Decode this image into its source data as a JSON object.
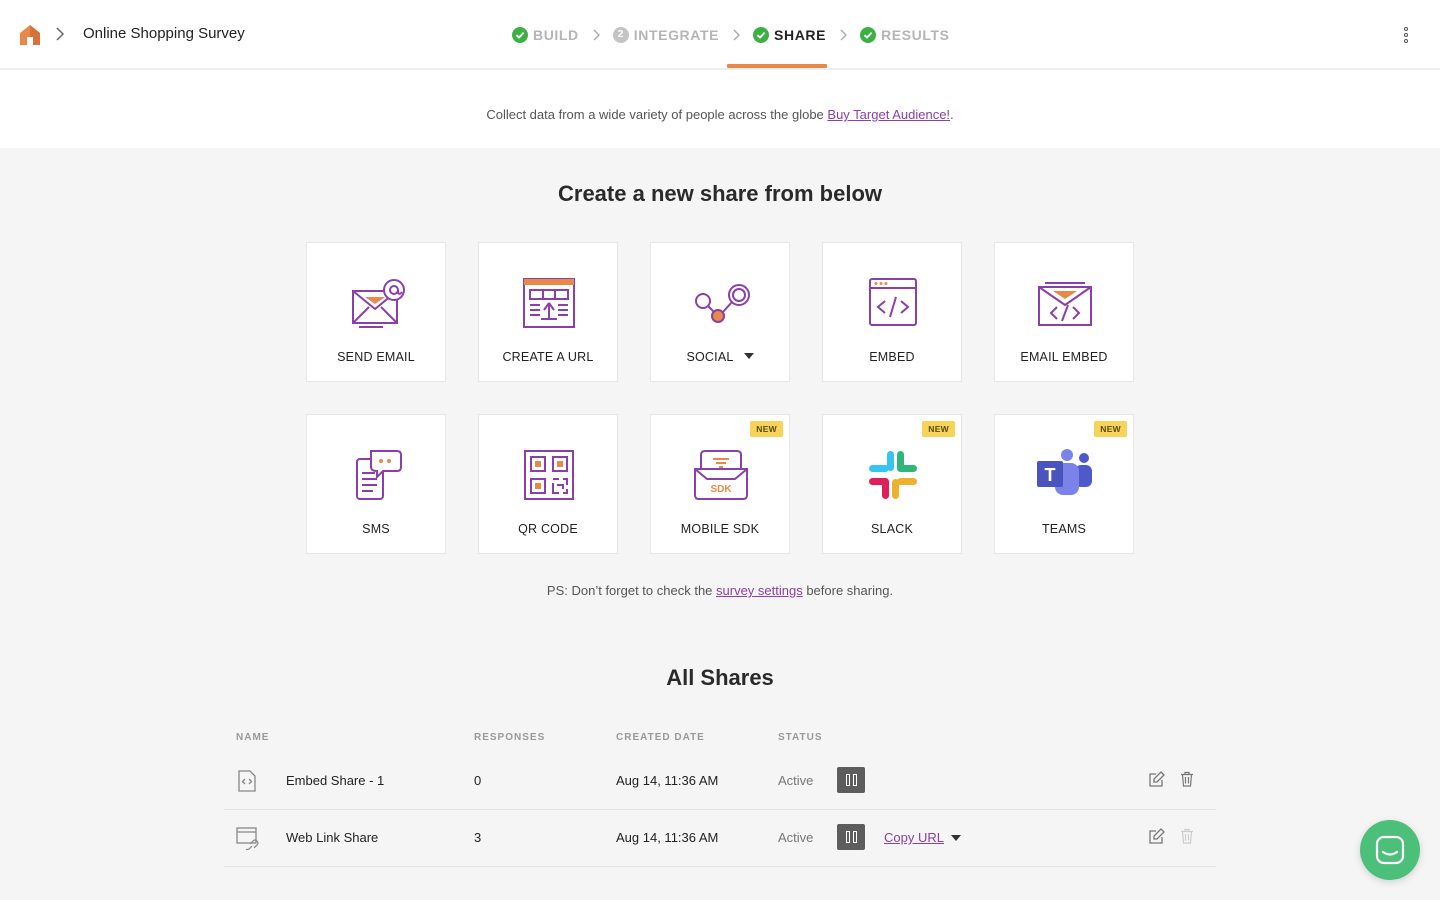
{
  "header": {
    "survey_title": "Online Shopping Survey",
    "steps": [
      {
        "label": "BUILD",
        "state": "done"
      },
      {
        "label": "INTEGRATE",
        "state": "number",
        "number": "2"
      },
      {
        "label": "SHARE",
        "state": "active"
      },
      {
        "label": "RESULTS",
        "state": "done"
      }
    ]
  },
  "promo": {
    "text": "Collect data from a wide variety of people across the globe ",
    "link": "Buy Target Audience!",
    "suffix": "."
  },
  "create": {
    "title": "Create a new share from below",
    "cards": [
      {
        "label": "SEND EMAIL",
        "icon": "email-icon"
      },
      {
        "label": "CREATE A URL",
        "icon": "url-icon"
      },
      {
        "label": "SOCIAL",
        "icon": "social-icon"
      },
      {
        "label": "EMBED",
        "icon": "embed-icon"
      },
      {
        "label": "EMAIL EMBED",
        "icon": "email-embed-icon"
      },
      {
        "label": "SMS",
        "icon": "sms-icon"
      },
      {
        "label": "QR CODE",
        "icon": "qr-code-icon"
      },
      {
        "label": "MOBILE SDK",
        "icon": "mobile-sdk-icon",
        "badge": "NEW",
        "icon_text": "SDK"
      },
      {
        "label": "SLACK",
        "icon": "slack-icon",
        "badge": "NEW"
      },
      {
        "label": "TEAMS",
        "icon": "teams-icon",
        "badge": "NEW",
        "icon_text": "T"
      }
    ]
  },
  "ps": {
    "prefix": "PS: Don’t forget to check the ",
    "link": "survey settings",
    "suffix": " before sharing."
  },
  "shares": {
    "title": "All Shares",
    "columns": [
      "NAME",
      "RESPONSES",
      "CREATED DATE",
      "STATUS"
    ],
    "rows": [
      {
        "name": "Embed Share - 1",
        "responses": "0",
        "created": "Aug 14, 11:36 AM",
        "status": "Active",
        "icon": "embed-share-icon"
      },
      {
        "name": "Web Link Share",
        "responses": "3",
        "created": "Aug 14, 11:36 AM",
        "status": "Active",
        "icon": "web-link-icon",
        "copy_label": "Copy URL"
      }
    ]
  },
  "colors": {
    "accent": "#e8894a",
    "purple": "#8b3fa8",
    "success": "#3cb043",
    "chat": "#4cc07a"
  }
}
